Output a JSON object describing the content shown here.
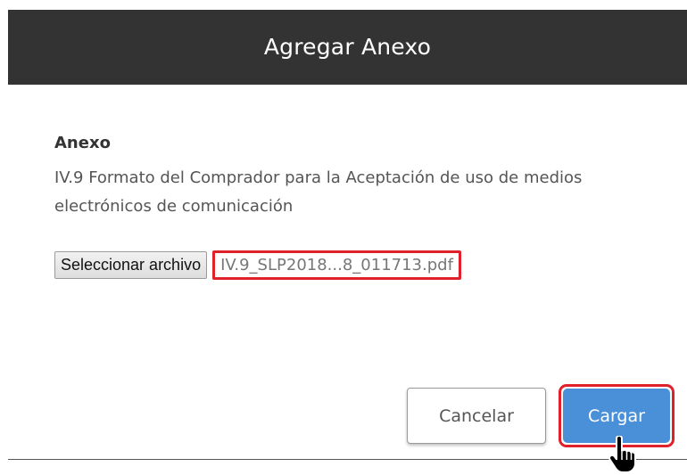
{
  "dialog": {
    "title": "Agregar Anexo"
  },
  "content": {
    "label": "Anexo",
    "description": "IV.9 Formato del Comprador para la Aceptación de uso de medios electrónicos de comunicación"
  },
  "file_input": {
    "button_label": "Seleccionar archivo",
    "file_name": "IV.9_SLP2018...8_011713.pdf"
  },
  "actions": {
    "cancel_label": "Cancelar",
    "upload_label": "Cargar"
  },
  "colors": {
    "header_bg": "#333333",
    "primary_button": "#4a90d9",
    "highlight": "#e0202a"
  },
  "icons": {
    "cursor": "hand-pointer-icon"
  }
}
